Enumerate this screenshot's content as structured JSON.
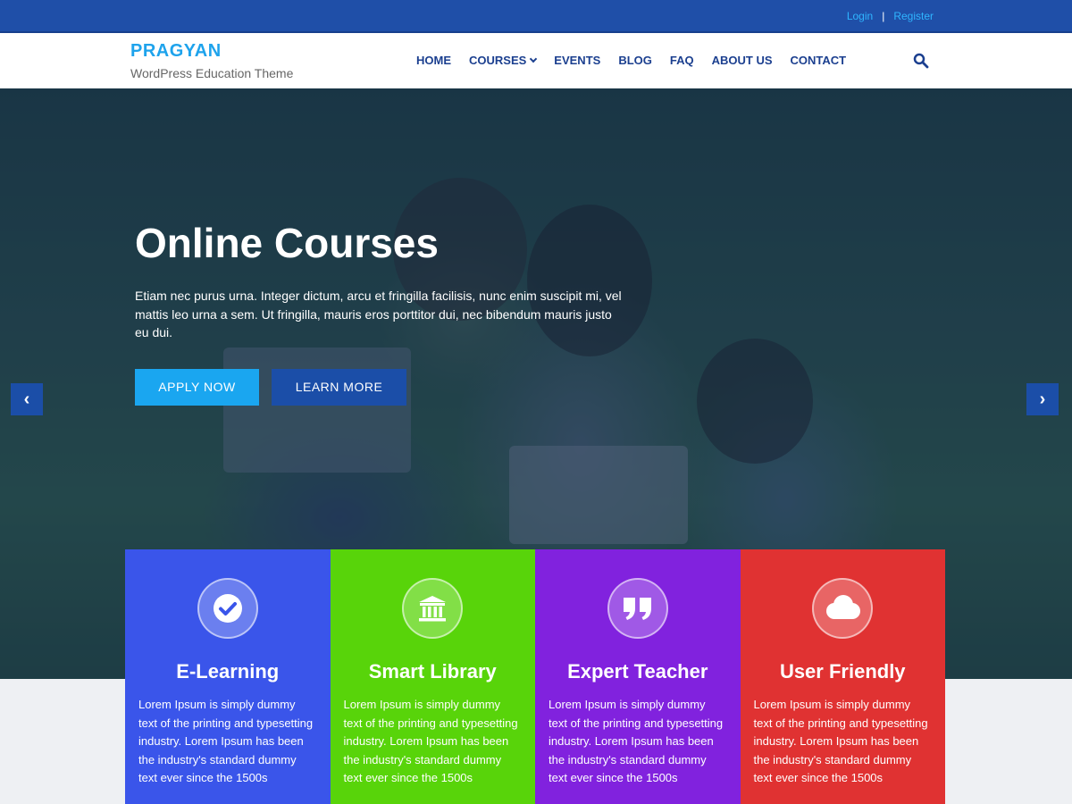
{
  "topbar": {
    "login": "Login",
    "separator": "|",
    "register": "Register"
  },
  "brand": {
    "name": "PRAGYAN",
    "tagline": "WordPress Education Theme"
  },
  "nav": [
    {
      "label": "HOME"
    },
    {
      "label": "COURSES"
    },
    {
      "label": "EVENTS"
    },
    {
      "label": "BLOG"
    },
    {
      "label": "FAQ"
    },
    {
      "label": "ABOUT US"
    },
    {
      "label": "CONTACT"
    }
  ],
  "hero": {
    "title": "Online Courses",
    "text": "Etiam nec purus urna. Integer dictum, arcu et fringilla facilisis, nunc enim suscipit mi, vel mattis leo urna a sem. Ut fringilla, mauris eros porttitor dui, nec bibendum mauris justo eu dui.",
    "apply_label": "APPLY NOW",
    "learn_label": "LEARN MORE",
    "prev_glyph": "‹",
    "next_glyph": "›"
  },
  "features": [
    {
      "title": "E-Learning",
      "icon": "check-circle-icon",
      "color": "#3a55ea",
      "text": "Lorem Ipsum is simply dummy text of the printing and typesetting industry. Lorem Ipsum has been the industry's standard dummy text ever since the 1500s"
    },
    {
      "title": "Smart Library",
      "icon": "institution-icon",
      "color": "#58d40a",
      "text": "Lorem Ipsum is simply dummy text of the printing and typesetting industry. Lorem Ipsum has been the industry's standard dummy text ever since the 1500s"
    },
    {
      "title": "Expert Teacher",
      "icon": "quote-icon",
      "color": "#8122de",
      "text": "Lorem Ipsum is simply dummy text of the printing and typesetting industry. Lorem Ipsum has been the industry's standard dummy text ever since the 1500s"
    },
    {
      "title": "User Friendly",
      "icon": "cloud-icon",
      "color": "#e03232",
      "text": "Lorem Ipsum is simply dummy text of the printing and typesetting industry. Lorem Ipsum has been the industry's standard dummy text ever since the 1500s"
    }
  ],
  "colors": {
    "topbar": "#1f4fa8",
    "brand": "#1ea3ec",
    "nav": "#1b3f8f",
    "apply": "#1aa6f0",
    "learn": "#1b4ea8"
  }
}
